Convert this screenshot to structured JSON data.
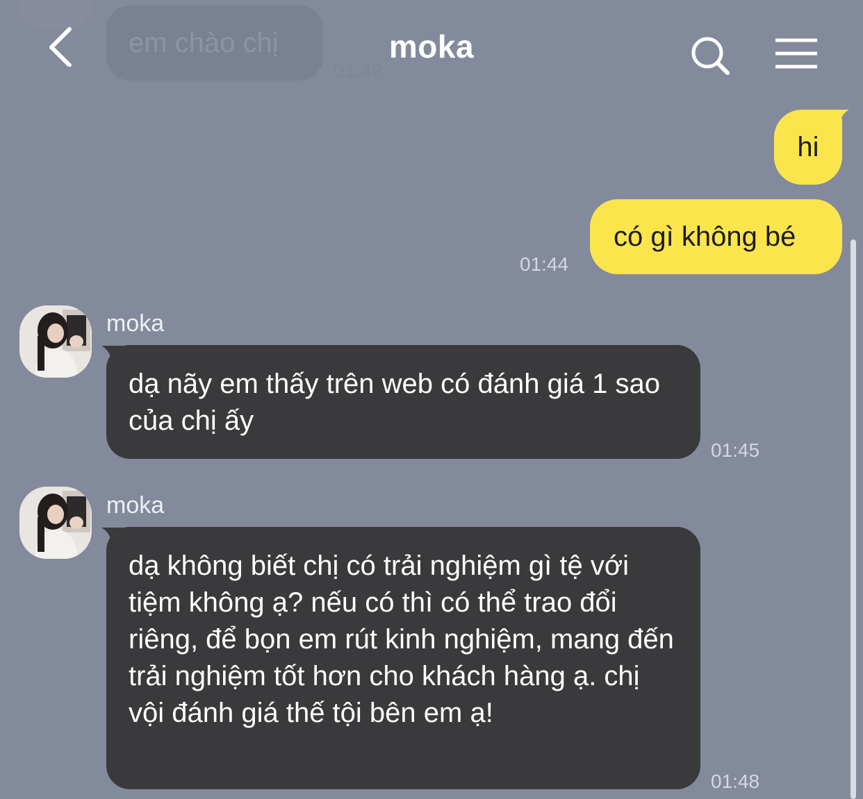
{
  "header": {
    "title": "moka"
  },
  "ghost": {
    "text": "em chào chị",
    "time": "01:42"
  },
  "messages": [
    {
      "side": "out",
      "text": "hi"
    },
    {
      "side": "out",
      "text": "có gì không bé",
      "time": "01:44"
    },
    {
      "side": "in",
      "sender": "moka",
      "text": "dạ nãy em thấy trên web có đánh giá 1 sao của chị ấy",
      "time": "01:45"
    },
    {
      "side": "in",
      "sender": "moka",
      "text": "dạ không biết chị có trải nghiệm gì tệ với tiệm không ạ? nếu có thì có thể trao đổi riêng, để bọn em rút kinh nghiệm, mang đến trải nghiệm tốt hơn cho khách hàng ạ. chị vội đánh giá thế tội bên em ạ!",
      "time": "01:48"
    }
  ],
  "colors": {
    "background": "#838a9b",
    "outgoing_bubble": "#fae54d",
    "incoming_bubble": "#3a3a3c"
  },
  "icons": {
    "back": "chevron-left-icon",
    "search": "search-icon",
    "menu": "hamburger-menu-icon"
  }
}
